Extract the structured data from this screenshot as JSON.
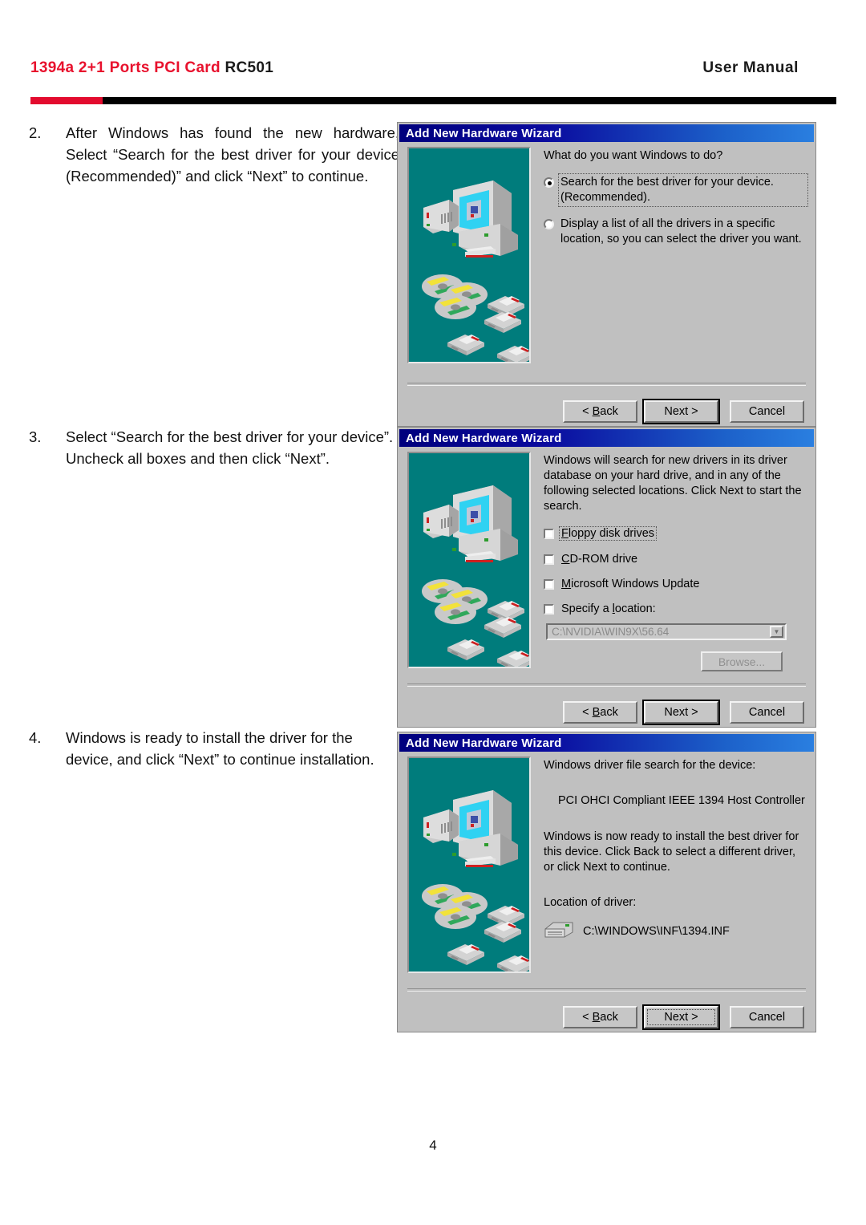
{
  "header": {
    "title_red": "1394a 2+1 Ports PCI Card",
    "title_black": "RC501",
    "right_label": "User Manual",
    "rule_color_red": "#e30b2e",
    "rule_color_black": "#000000"
  },
  "steps": [
    {
      "number": "2.",
      "text": "After Windows has found the new hardware, Select “Search for the best driver for your device (Recommended)” and click “Next” to continue."
    },
    {
      "number": "3.",
      "text": "Select “Search for the best driver for your device”. Uncheck all boxes and then click “Next”."
    },
    {
      "number": "4.",
      "text": "Windows is ready to install the driver for the device, and click “Next” to continue installation."
    }
  ],
  "dialogs": [
    {
      "title": "Add New Hardware Wizard",
      "prompt": "What do you want Windows to do?",
      "options": [
        {
          "label": "Search for the best driver for your device. (Recommended).",
          "selected": true,
          "focused": true
        },
        {
          "label": "Display a list of all the drivers in a specific location, so you can select the driver you want.",
          "selected": false,
          "focused": false
        }
      ],
      "buttons": {
        "back": "< Back",
        "back_accel": "B",
        "next": "Next >",
        "cancel": "Cancel",
        "default": "next"
      }
    },
    {
      "title": "Add New Hardware Wizard",
      "prompt": "Windows will search for new drivers in its driver database on your hard drive, and in any of the following selected locations. Click Next to start the search.",
      "checkboxes": [
        {
          "label": "Floppy disk drives",
          "accel": "F",
          "checked": false,
          "focused": true
        },
        {
          "label": "CD-ROM drive",
          "accel": "C",
          "checked": false,
          "focused": false
        },
        {
          "label": "Microsoft Windows Update",
          "accel": "M",
          "checked": false,
          "focused": false
        },
        {
          "label": "Specify a location:",
          "accel": "l",
          "checked": false,
          "focused": false
        }
      ],
      "location_combo_value": "C:\\NVIDIA\\WIN9X\\56.64",
      "browse_label": "Browse...",
      "buttons": {
        "back": "< Back",
        "back_accel": "B",
        "next": "Next >",
        "cancel": "Cancel",
        "default": "next"
      }
    },
    {
      "title": "Add New Hardware Wizard",
      "prompt": "Windows driver file search for the device:",
      "device_name": "PCI OHCI Compliant IEEE 1394 Host Controller",
      "ready_text": "Windows is now ready to install the best driver for this device. Click Back to select a different driver, or click Next to continue.",
      "location_label": "Location of driver:",
      "driver_path": "C:\\WINDOWS\\INF\\1394.INF",
      "buttons": {
        "back": "< Back",
        "back_accel": "B",
        "next": "Next >",
        "cancel": "Cancel",
        "default": "next"
      }
    }
  ],
  "footer": {
    "page_number": "4"
  }
}
